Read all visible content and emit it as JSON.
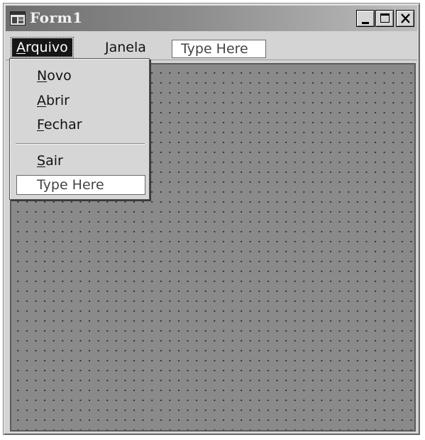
{
  "window": {
    "title": "Form1",
    "controls": [
      "minimize-icon",
      "maximize-icon",
      "close-icon"
    ]
  },
  "menubar": {
    "items": [
      {
        "first": "A",
        "rest": "rquivo",
        "active": true
      },
      {
        "first": "J",
        "rest": "anela",
        "active": false
      }
    ],
    "type_here": "Type Here"
  },
  "dropdown": {
    "items": [
      {
        "first": "N",
        "rest": "ovo"
      },
      {
        "first": "A",
        "rest": "brir"
      },
      {
        "first": "F",
        "rest": "echar"
      },
      {
        "first": "S",
        "rest": "air"
      }
    ],
    "type_here": "Type Here"
  },
  "colors": {
    "canvas": "#8a8a8a",
    "grid_dot": "#2e2e2e",
    "active_menu_bg": "#161616"
  }
}
